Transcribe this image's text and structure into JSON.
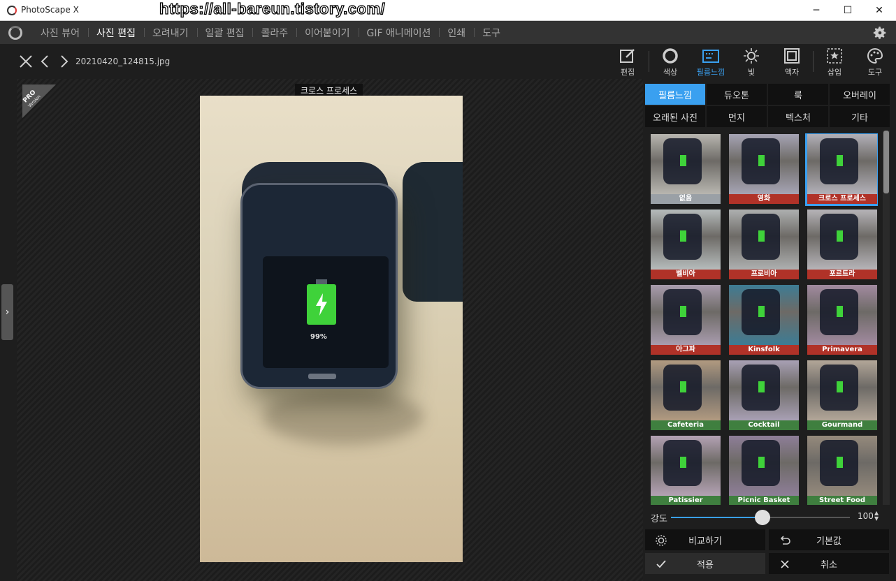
{
  "window": {
    "title": "PhotoScape X",
    "watermark": "https://all-bareun.tistory.com/",
    "controls": {
      "minimize": "─",
      "maximize": "☐",
      "close": "✕"
    }
  },
  "menu": {
    "tabs": [
      {
        "label": "사진 뷰어",
        "active": false
      },
      {
        "label": "사진 편집",
        "active": true
      },
      {
        "label": "오려내기",
        "active": false
      },
      {
        "label": "일괄 편집",
        "active": false
      },
      {
        "label": "콜라주",
        "active": false
      },
      {
        "label": "이어붙이기",
        "active": false
      },
      {
        "label": "GIF 애니메이션",
        "active": false
      },
      {
        "label": "인쇄",
        "active": false
      },
      {
        "label": "도구",
        "active": false
      }
    ]
  },
  "toolbar": {
    "filename": "20210420_124815.jpg",
    "tools": [
      {
        "label": "편집",
        "icon": "edit-icon",
        "active": false
      },
      {
        "label": "색상",
        "icon": "color-circle-icon",
        "active": false
      },
      {
        "label": "필름느낌",
        "icon": "film-icon",
        "active": true
      },
      {
        "label": "빛",
        "icon": "sun-icon",
        "active": false
      },
      {
        "label": "액자",
        "icon": "frame-icon",
        "active": false
      },
      {
        "label": "삽입",
        "icon": "insert-star-icon",
        "active": false
      },
      {
        "label": "도구",
        "icon": "palette-icon",
        "active": false
      }
    ]
  },
  "canvas": {
    "badge": {
      "pro": "PRO",
      "version": "Version"
    },
    "effect_label": "크로스 프로세스",
    "photo_battery_text": "99%"
  },
  "panel": {
    "categories_row1": [
      "필름느낌",
      "듀오톤",
      "룩",
      "오버레이"
    ],
    "categories_row2": [
      "오래된 사진",
      "먼지",
      "텍스처",
      "기타"
    ],
    "active_category": "필름느낌",
    "filters": [
      {
        "label": "없음",
        "label_color": "#9aa0a6",
        "tint": "#b8b6b0"
      },
      {
        "label": "영화",
        "label_color": "#b03228",
        "tint": "#a6a4b4"
      },
      {
        "label": "크로스 프로세스",
        "label_color": "#b03228",
        "tint": "#b2b0b8",
        "selected": true
      },
      {
        "label": "벨비아",
        "label_color": "#b03228",
        "tint": "#b6bcbc"
      },
      {
        "label": "프로비아",
        "label_color": "#b03228",
        "tint": "#aeb0b0"
      },
      {
        "label": "포르트라",
        "label_color": "#b03228",
        "tint": "#b6b4b8"
      },
      {
        "label": "아그파",
        "label_color": "#b03228",
        "tint": "#a99cae"
      },
      {
        "label": "Kinsfolk",
        "label_color": "#b03228",
        "tint": "#3d7c94"
      },
      {
        "label": "Primavera",
        "label_color": "#b03228",
        "tint": "#a28aa0"
      },
      {
        "label": "Cafeteria",
        "label_color": "#3f7f3f",
        "tint": "#b19a80"
      },
      {
        "label": "Cocktail",
        "label_color": "#3f7f3f",
        "tint": "#a8a0b4"
      },
      {
        "label": "Gourmand",
        "label_color": "#3f7f3f",
        "tint": "#b2a698"
      },
      {
        "label": "Patissier",
        "label_color": "#3f7f3f",
        "tint": "#b4a2b4"
      },
      {
        "label": "Picnic Basket",
        "label_color": "#3f7f3f",
        "tint": "#8e7e98"
      },
      {
        "label": "Street Food",
        "label_color": "#3f7f3f",
        "tint": "#958a7c"
      }
    ],
    "strength": {
      "label": "강도",
      "value": "100",
      "fraction": 0.51
    },
    "buttons": {
      "compare": "비교하기",
      "reset": "기본값",
      "apply": "적용",
      "cancel": "취소"
    }
  },
  "colors": {
    "accent": "#3aa0f0",
    "battery": "#3fd23a"
  }
}
